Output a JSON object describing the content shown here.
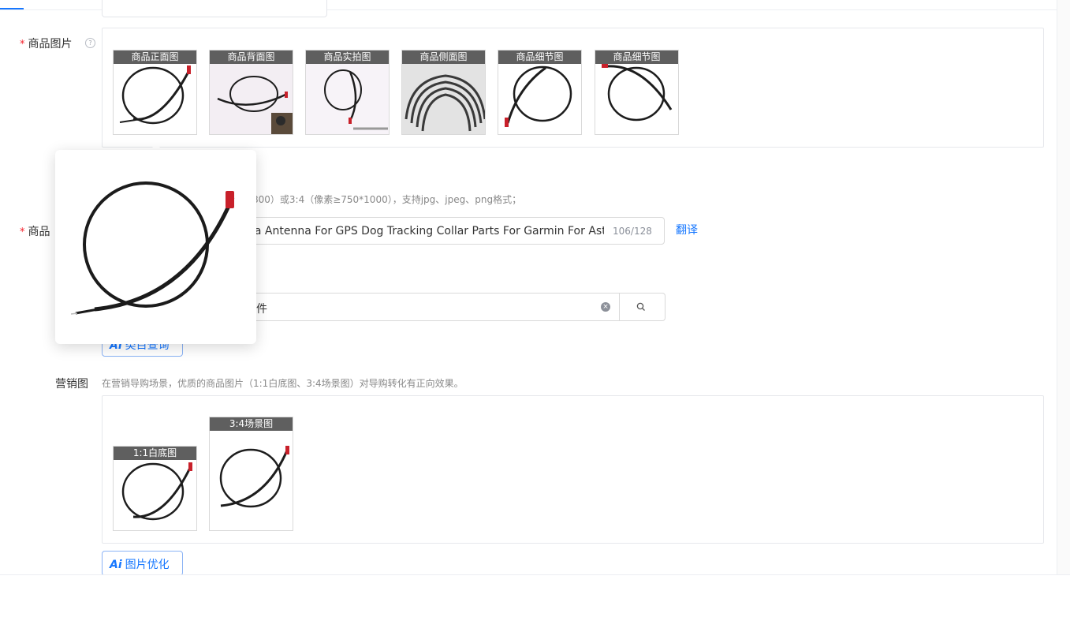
{
  "colors": {
    "accent": "#1677ff",
    "required": "#f5222d",
    "caption_bg": "#5f5f5f"
  },
  "product_images": {
    "label": "商品图片",
    "help_icon": "question-circle-icon",
    "thumbnails": [
      {
        "caption": "商品正面图"
      },
      {
        "caption": "商品背面图"
      },
      {
        "caption": "商品实拍图"
      },
      {
        "caption": "商品侧面图"
      },
      {
        "caption": "商品细节图"
      },
      {
        "caption": "商品细节图"
      }
    ],
    "hint": "800）或3:4（像素≥750*1000），支持jpg、jpeg、png格式；"
  },
  "product_title": {
    "label": "商品",
    "value": "na Antenna For GPS Dog Tracking Collar Parts For Garmin For Ast",
    "counter": "106/128",
    "translate_label": "翻译"
  },
  "category_search": {
    "value": "件",
    "clear_icon": "clear-icon",
    "search_icon": "search-icon"
  },
  "ai_category_button": {
    "ai_mark": "Ai",
    "label": "类目查询"
  },
  "marketing_images": {
    "label": "营销图",
    "hint": "在营销导购场景，优质的商品图片（1:1白底图、3:4场景图）对导购转化有正向效果。",
    "thumbnails": [
      {
        "caption": "1:1白底图"
      },
      {
        "caption": "3:4场景图"
      }
    ]
  },
  "ai_optimize_button": {
    "ai_mark": "Ai",
    "label": "图片优化"
  }
}
